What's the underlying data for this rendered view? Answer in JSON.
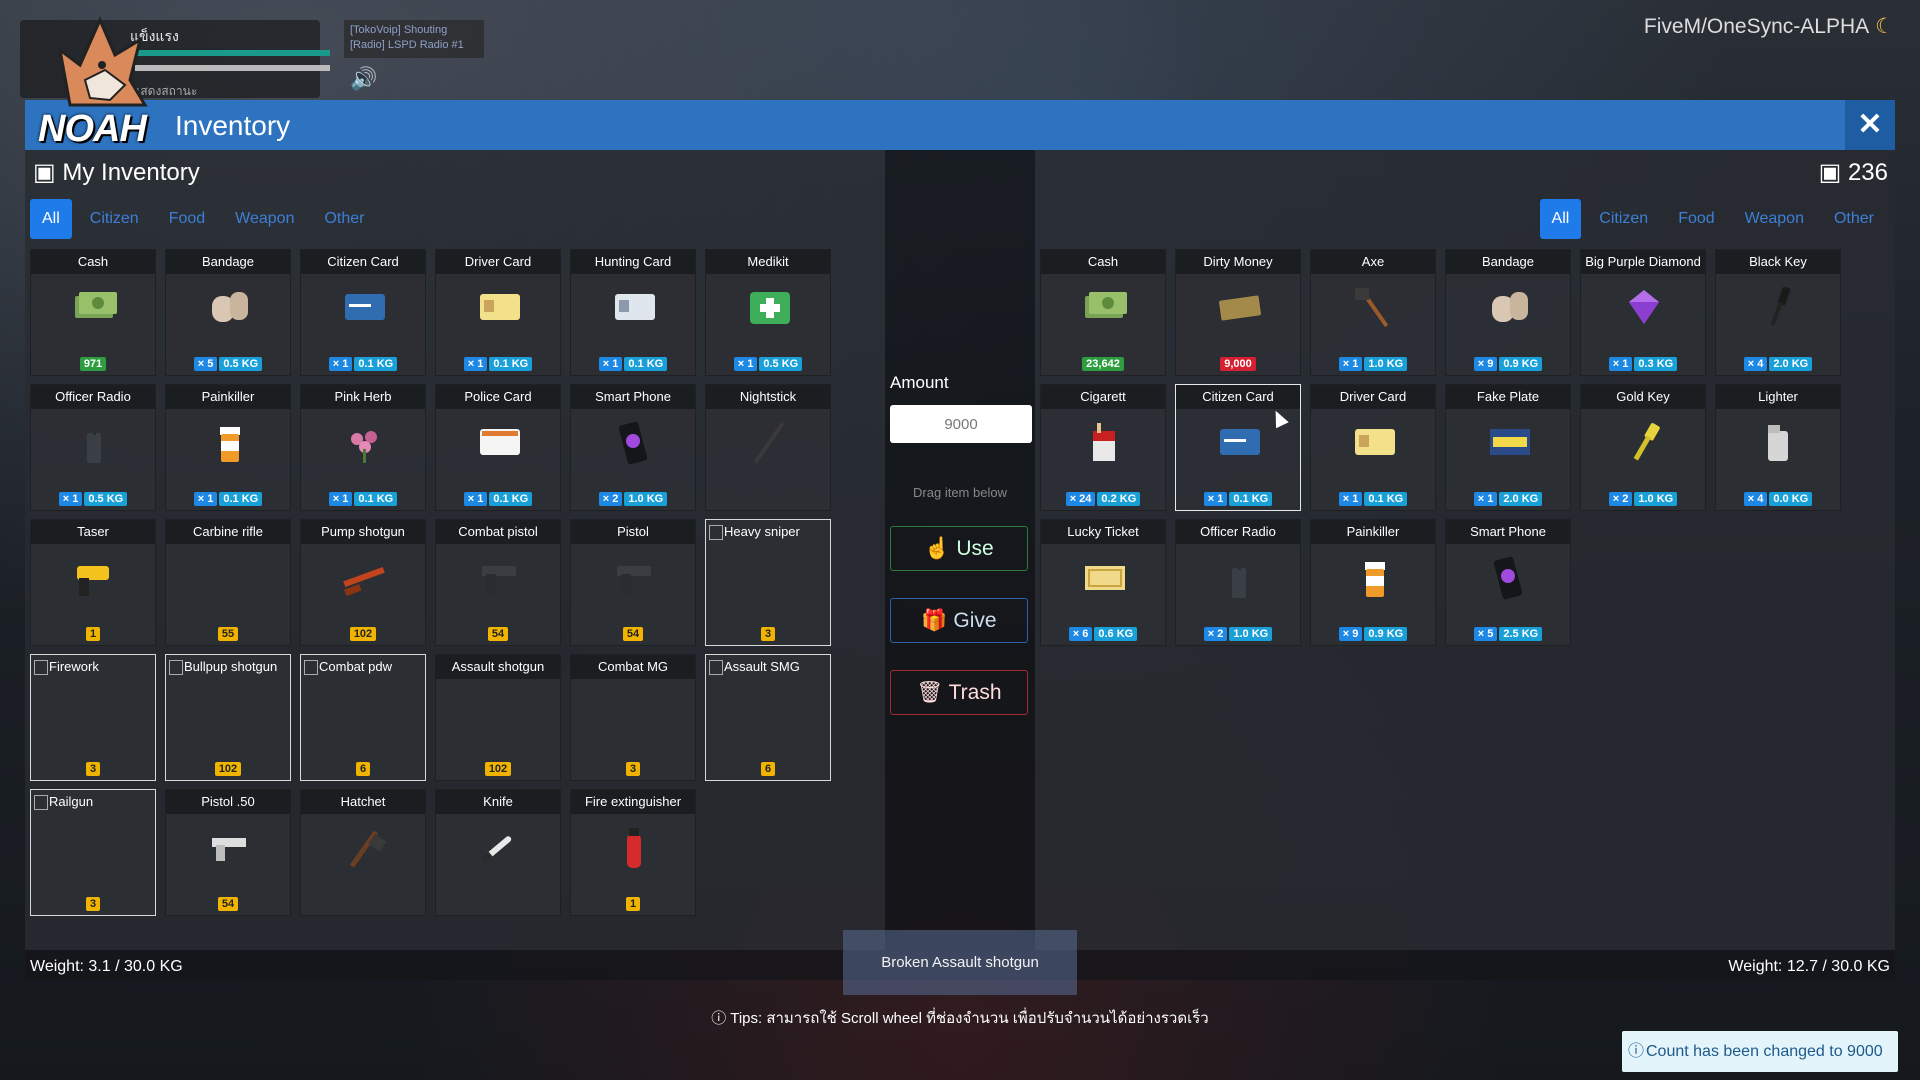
{
  "hud": {
    "label": "แข็งแรง",
    "subtext": "ค้างไว้เพื่อแสดงสถานะ",
    "voip_line1": "[TokoVoip] Shouting",
    "voip_line2": "[Radio] LSPD Radio #1"
  },
  "server": {
    "name": "FiveM/OneSync-ALPHA"
  },
  "window": {
    "title": "Inventory",
    "logo_text": "NOAH"
  },
  "left": {
    "title": "My Inventory",
    "tabs": [
      "All",
      "Citizen",
      "Food",
      "Weapon",
      "Other"
    ],
    "weight": "Weight: 3.1 / 30.0 KG",
    "items": [
      {
        "name": "Cash",
        "icon": "cash",
        "badges": [
          {
            "t": "971",
            "c": "green"
          }
        ]
      },
      {
        "name": "Bandage",
        "icon": "bandage",
        "badges": [
          {
            "t": "× 5",
            "c": "qty"
          },
          {
            "t": "0.5 KG",
            "c": "kg"
          }
        ]
      },
      {
        "name": "Citizen Card",
        "icon": "card-blue",
        "badges": [
          {
            "t": "× 1",
            "c": "qty"
          },
          {
            "t": "0.1 KG",
            "c": "kg"
          }
        ]
      },
      {
        "name": "Driver Card",
        "icon": "card-yellow",
        "badges": [
          {
            "t": "× 1",
            "c": "qty"
          },
          {
            "t": "0.1 KG",
            "c": "kg"
          }
        ]
      },
      {
        "name": "Hunting Card",
        "icon": "card-grey",
        "badges": [
          {
            "t": "× 1",
            "c": "qty"
          },
          {
            "t": "0.1 KG",
            "c": "kg"
          }
        ]
      },
      {
        "name": "Medikit",
        "icon": "medikit",
        "badges": [
          {
            "t": "× 1",
            "c": "qty"
          },
          {
            "t": "0.5 KG",
            "c": "kg"
          }
        ]
      },
      {
        "name": "Officer Radio",
        "icon": "radio",
        "badges": [
          {
            "t": "× 1",
            "c": "qty"
          },
          {
            "t": "0.5 KG",
            "c": "kg"
          }
        ]
      },
      {
        "name": "Painkiller",
        "icon": "pills",
        "badges": [
          {
            "t": "× 1",
            "c": "qty"
          },
          {
            "t": "0.1 KG",
            "c": "kg"
          }
        ]
      },
      {
        "name": "Pink Herb",
        "icon": "herb",
        "badges": [
          {
            "t": "× 1",
            "c": "qty"
          },
          {
            "t": "0.1 KG",
            "c": "kg"
          }
        ]
      },
      {
        "name": "Police Card",
        "icon": "card-white",
        "badges": [
          {
            "t": "× 1",
            "c": "qty"
          },
          {
            "t": "0.1 KG",
            "c": "kg"
          }
        ]
      },
      {
        "name": "Smart Phone",
        "icon": "phone",
        "badges": [
          {
            "t": "× 2",
            "c": "qty"
          },
          {
            "t": "1.0 KG",
            "c": "kg"
          }
        ]
      },
      {
        "name": "Nightstick",
        "icon": "nightstick",
        "badges": []
      },
      {
        "name": "Taser",
        "icon": "taser",
        "badges": [
          {
            "t": "1",
            "c": "ammo"
          }
        ]
      },
      {
        "name": "Carbine rifle",
        "icon": "rifle",
        "badges": [
          {
            "t": "55",
            "c": "ammo"
          }
        ]
      },
      {
        "name": "Pump shotgun",
        "icon": "shotgun",
        "badges": [
          {
            "t": "102",
            "c": "ammo"
          }
        ]
      },
      {
        "name": "Combat pistol",
        "icon": "pistol",
        "badges": [
          {
            "t": "54",
            "c": "ammo"
          }
        ]
      },
      {
        "name": "Pistol",
        "icon": "pistol",
        "badges": [
          {
            "t": "54",
            "c": "ammo"
          }
        ]
      },
      {
        "name": "Heavy sniper",
        "icon": "broken",
        "broken": true,
        "badges": [
          {
            "t": "3",
            "c": "ammo"
          }
        ]
      },
      {
        "name": "Firework",
        "icon": "broken",
        "broken": true,
        "badges": [
          {
            "t": "3",
            "c": "ammo"
          }
        ]
      },
      {
        "name": "Bullpup shotgun",
        "icon": "broken",
        "broken": true,
        "badges": [
          {
            "t": "102",
            "c": "ammo"
          }
        ]
      },
      {
        "name": "Combat pdw",
        "icon": "broken",
        "broken": true,
        "badges": [
          {
            "t": "6",
            "c": "ammo"
          }
        ]
      },
      {
        "name": "Assault shotgun",
        "icon": "rifle",
        "badges": [
          {
            "t": "102",
            "c": "ammo"
          }
        ]
      },
      {
        "name": "Combat MG",
        "icon": "rifle",
        "badges": [
          {
            "t": "3",
            "c": "ammo"
          }
        ]
      },
      {
        "name": "Assault SMG",
        "icon": "broken",
        "broken": true,
        "badges": [
          {
            "t": "6",
            "c": "ammo"
          }
        ]
      },
      {
        "name": "Railgun",
        "icon": "broken",
        "broken": true,
        "badges": [
          {
            "t": "3",
            "c": "ammo"
          }
        ]
      },
      {
        "name": "Pistol .50",
        "icon": "pistol-silver",
        "badges": [
          {
            "t": "54",
            "c": "ammo"
          }
        ]
      },
      {
        "name": "Hatchet",
        "icon": "hatchet",
        "badges": []
      },
      {
        "name": "Knife",
        "icon": "knife",
        "badges": []
      },
      {
        "name": "Fire extinguisher",
        "icon": "extinguisher",
        "badges": [
          {
            "t": "1",
            "c": "ammo"
          }
        ]
      }
    ]
  },
  "right": {
    "count": "236",
    "tabs": [
      "All",
      "Citizen",
      "Food",
      "Weapon",
      "Other"
    ],
    "weight": "Weight: 12.7 / 30.0 KG",
    "items": [
      {
        "name": "Cash",
        "icon": "cash",
        "badges": [
          {
            "t": "23,642",
            "c": "green"
          }
        ]
      },
      {
        "name": "Dirty Money",
        "icon": "dirty-money",
        "badges": [
          {
            "t": "9,000",
            "c": "red"
          }
        ]
      },
      {
        "name": "Axe",
        "icon": "axe",
        "badges": [
          {
            "t": "× 1",
            "c": "qty"
          },
          {
            "t": "1.0 KG",
            "c": "kg"
          }
        ]
      },
      {
        "name": "Bandage",
        "icon": "bandage",
        "badges": [
          {
            "t": "× 9",
            "c": "qty"
          },
          {
            "t": "0.9 KG",
            "c": "kg"
          }
        ]
      },
      {
        "name": "Big Purple Diamond",
        "icon": "diamond",
        "badges": [
          {
            "t": "× 1",
            "c": "qty"
          },
          {
            "t": "0.3 KG",
            "c": "kg"
          }
        ]
      },
      {
        "name": "Black Key",
        "icon": "key-black",
        "badges": [
          {
            "t": "× 4",
            "c": "qty"
          },
          {
            "t": "2.0 KG",
            "c": "kg"
          }
        ]
      },
      {
        "name": "Cigarett",
        "icon": "cigarette",
        "badges": [
          {
            "t": "× 24",
            "c": "qty"
          },
          {
            "t": "0.2 KG",
            "c": "kg"
          }
        ]
      },
      {
        "name": "Citizen Card",
        "icon": "card-blue",
        "selected": true,
        "badges": [
          {
            "t": "× 1",
            "c": "qty"
          },
          {
            "t": "0.1 KG",
            "c": "kg"
          }
        ]
      },
      {
        "name": "Driver Card",
        "icon": "card-yellow",
        "badges": [
          {
            "t": "× 1",
            "c": "qty"
          },
          {
            "t": "0.1 KG",
            "c": "kg"
          }
        ]
      },
      {
        "name": "Fake Plate",
        "icon": "plate",
        "badges": [
          {
            "t": "× 1",
            "c": "qty"
          },
          {
            "t": "2.0 KG",
            "c": "kg"
          }
        ]
      },
      {
        "name": "Gold Key",
        "icon": "key-gold",
        "badges": [
          {
            "t": "× 2",
            "c": "qty"
          },
          {
            "t": "1.0 KG",
            "c": "kg"
          }
        ]
      },
      {
        "name": "Lighter",
        "icon": "lighter",
        "badges": [
          {
            "t": "× 4",
            "c": "qty"
          },
          {
            "t": "0.0 KG",
            "c": "kg"
          }
        ]
      },
      {
        "name": "Lucky Ticket",
        "icon": "ticket",
        "badges": [
          {
            "t": "× 6",
            "c": "qty"
          },
          {
            "t": "0.6 KG",
            "c": "kg"
          }
        ]
      },
      {
        "name": "Officer Radio",
        "icon": "radio",
        "badges": [
          {
            "t": "× 2",
            "c": "qty"
          },
          {
            "t": "1.0 KG",
            "c": "kg"
          }
        ]
      },
      {
        "name": "Painkiller",
        "icon": "pills",
        "badges": [
          {
            "t": "× 9",
            "c": "qty"
          },
          {
            "t": "0.9 KG",
            "c": "kg"
          }
        ]
      },
      {
        "name": "Smart Phone",
        "icon": "phone",
        "badges": [
          {
            "t": "× 5",
            "c": "qty"
          },
          {
            "t": "2.5 KG",
            "c": "kg"
          }
        ]
      }
    ]
  },
  "middle": {
    "amount_label": "Amount",
    "amount_value": "9000",
    "drag_hint": "Drag item below",
    "use": "Use",
    "give": "Give",
    "trash": "Trash",
    "drag_ghost": "Broken Assault shotgun"
  },
  "tips": "Tips: สามารถใช้ Scroll wheel ที่ช่องจำนวน เพื่อปรับจำนวนได้อย่างรวดเร็ว",
  "toast": "Count has been changed to 9000",
  "colors": {
    "accent": "#1f7bea",
    "titlebar": "#2d73c0",
    "use": "#2c7a3b",
    "give": "#2a62a8",
    "trash": "#a02a36"
  }
}
